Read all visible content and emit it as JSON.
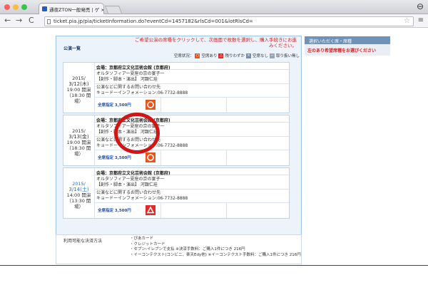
{
  "browser": {
    "tab_title": "通夜ZTON一般発売 | ゲ ×",
    "url": "ticket.pia.jp/pia/ticketInformation.do?eventCd=1457182&rlsCd=001&lotRlsCd="
  },
  "page": {
    "list_button": "公演一覧",
    "notice": "ご希望公演の席種をクリックして、次画面で枚数を選択し、購入手続きにお進みください。",
    "legend_prefix": "空席状況：",
    "legend": [
      {
        "mark": "○",
        "label": "空席あり",
        "color": "#e9541a"
      },
      {
        "mark": "△",
        "label": "残りわずか",
        "color": "#e12a2a"
      },
      {
        "mark": "×",
        "label": "空席なし",
        "color": "#7b8ca6"
      },
      {
        "mark": "−",
        "label": "取り扱い無し",
        "color": "#9aa6b6"
      }
    ],
    "sidebar": {
      "header": "選択いただく席・席種",
      "body": "左のあり希望席種をお選びください"
    },
    "performances": [
      {
        "year": "2015/",
        "date": "3/12(木)",
        "start": "19:00 開演",
        "open": "（18:30 開場）",
        "venue": "会場：京都府立文化芸術会館 (京都府)",
        "title": "オルタソフィアー夏座の京の宴子一",
        "credits": "【創作・脚本・演出】 河顕仁珪",
        "contact_label": "公演などに関するお問い合わせ先",
        "contact": "キョードーインフォメーション:06-7732-8888",
        "seat": "全席指定 3,500円",
        "availability": "circle",
        "date_color": "default"
      },
      {
        "year": "2015/",
        "date": "3/13(金)",
        "start": "19:00 開演",
        "open": "（18:30 開場）",
        "venue": "会場：京都府立文化芸術会館 (京都府)",
        "title": "オルタソフィアー夏座の京の宴子一",
        "credits": "【創作・脚本・演出】 河顕仁珪",
        "contact_label": "公演などに関するお問い合わせ先",
        "contact": "キョードーインフォメーション:06-7732-8888",
        "seat": "全席指定 3,500円",
        "availability": "circle",
        "date_color": "default"
      },
      {
        "year": "2015/",
        "date": "3/14(土)",
        "start": "14:00 開演",
        "open": "（13:30 開場）",
        "venue": "会場：京都府立文化芸術会館 (京都府)",
        "title": "オルタソフィアー夏座の京の宴子一",
        "credits": "【創作・脚本・演出】 河顕仁珪",
        "contact_label": "公演などに関するお問い合わせ先",
        "contact": "キョードーインフォメーション:06-7732-8888",
        "seat": "全席指定 3,500円",
        "availability": "triangle",
        "date_color": "blue"
      }
    ],
    "payment": {
      "label": "利用可能な決済方法",
      "items": [
        "・ぴあカード",
        "・クレジットカード",
        "・セブン-イレブンで支払 ※決済手数料：ご購入1件につき 216円",
        "・イーコンテクスト(コンビニ、楽天Edy他) ※イーコンテクスト手数料：ご購入1件につき 216円"
      ]
    },
    "colors": {
      "accent_red": "#d21f1f",
      "link_blue": "#1a4fb4",
      "panel_bg": "#ecf3fb",
      "border_blue": "#9ec3e6",
      "available_orange": "#e9541a"
    }
  }
}
